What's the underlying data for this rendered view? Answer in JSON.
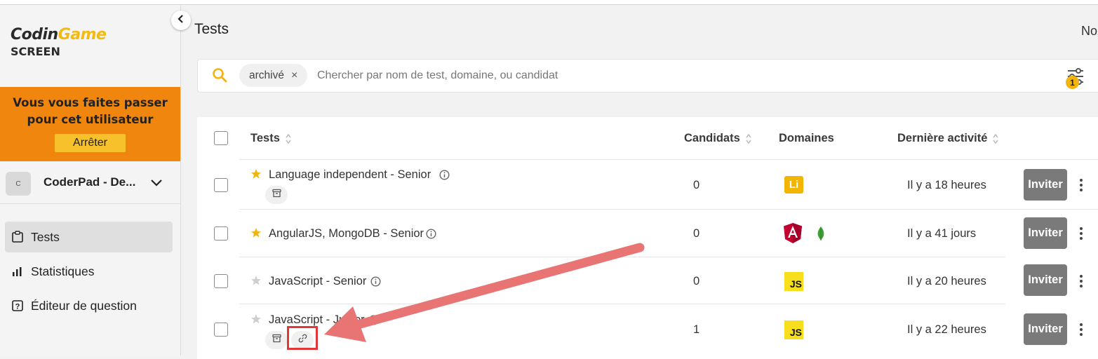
{
  "app": {
    "logo_main": "Codin",
    "logo_accent": "Game",
    "logo_sub": "SCREEN"
  },
  "impersonation": {
    "message": "Vous vous faites passer pour cet utilisateur",
    "stop_label": "Arrêter"
  },
  "org": {
    "avatar": "C",
    "name": "CoderPad - De..."
  },
  "nav": [
    {
      "label": "Tests",
      "icon": "clipboard-icon",
      "active": true
    },
    {
      "label": "Statistiques",
      "icon": "bar-chart-icon",
      "active": false
    },
    {
      "label": "Éditeur de question",
      "icon": "question-square-icon",
      "active": false
    }
  ],
  "header": {
    "title": "Tests",
    "right_text": "No"
  },
  "search": {
    "chip_label": "archivé",
    "chip_remove": "×",
    "placeholder": "Chercher par nom de test, domaine, ou candidat",
    "filter_count": "1"
  },
  "table": {
    "columns": {
      "tests": "Tests",
      "candidates": "Candidats",
      "domains": "Domaines",
      "last_activity": "Dernière activité"
    },
    "invite_label": "Inviter",
    "rows": [
      {
        "name": "Language independent - Senior",
        "starred": true,
        "candidates": "0",
        "domains": [
          "Li"
        ],
        "activity": "Il y a 18 heures",
        "badges": [
          "archive-icon"
        ]
      },
      {
        "name": "AngularJS, MongoDB - Senior",
        "starred": true,
        "candidates": "0",
        "domains": [
          "angular-icon",
          "mongodb-icon"
        ],
        "activity": "Il y a 41 jours",
        "badges": []
      },
      {
        "name": "JavaScript - Senior",
        "starred": false,
        "candidates": "0",
        "domains": [
          "JS"
        ],
        "activity": "Il y a 20 heures",
        "badges": []
      },
      {
        "name": "JavaScript - Junior",
        "starred": false,
        "candidates": "1",
        "domains": [
          "JS"
        ],
        "activity": "Il y a 22 heures",
        "badges": [
          "archive-icon",
          "link-icon"
        ]
      }
    ]
  },
  "colors": {
    "accent": "#f2bb13",
    "banner": "#f0860e",
    "annotation": "#e03838"
  }
}
